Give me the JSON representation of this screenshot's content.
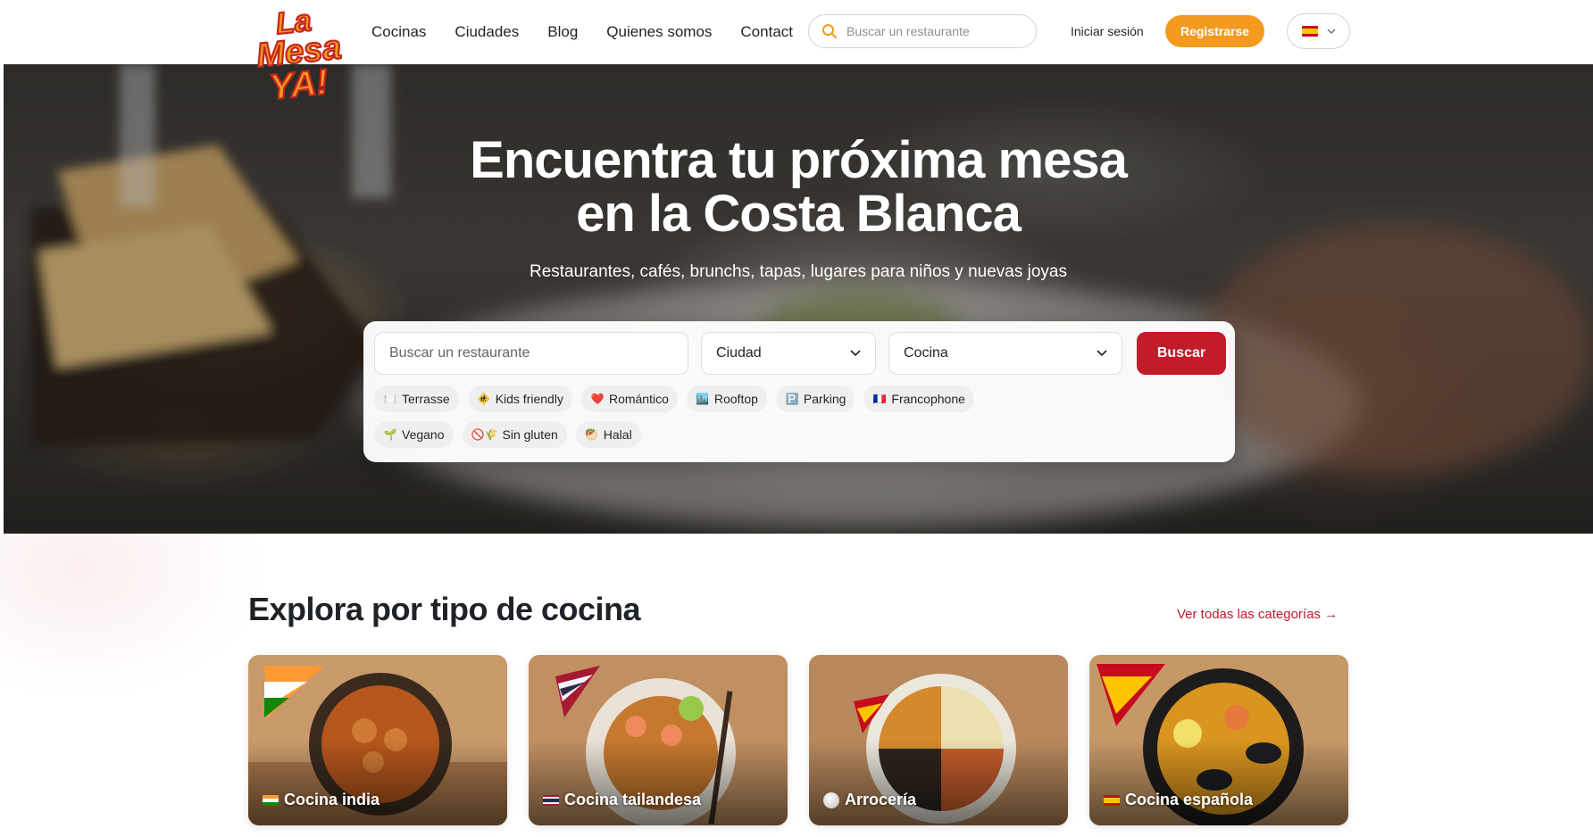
{
  "brand": {
    "logo_line1": "La",
    "logo_line2": "Mesa",
    "logo_line3": "YA!",
    "accent": "#f39a1f",
    "primary_red": "#c21b2a"
  },
  "nav": {
    "links": [
      {
        "label": "Cocinas"
      },
      {
        "label": "Ciudades"
      },
      {
        "label": "Blog"
      },
      {
        "label": "Quienes somos"
      },
      {
        "label": "Contact"
      }
    ],
    "search_placeholder": "Buscar un restaurante",
    "search_icon": "search-icon",
    "login_label": "Iniciar sesión",
    "register_label": "Registrarse",
    "language_flag": "flag-es-icon"
  },
  "hero": {
    "title_line1": "Encuentra tu próxima mesa",
    "title_line2": "en la Costa Blanca",
    "subtitle": "Restaurantes, cafés, brunchs, tapas, lugares para niños y nuevas joyas",
    "search_placeholder": "Buscar un restaurante",
    "city_label": "Ciudad",
    "cuisine_label": "Cocina",
    "search_button": "Buscar",
    "chips": [
      {
        "icon": "🍽️",
        "label": "Terrasse"
      },
      {
        "icon": "🚸",
        "label": "Kids friendly"
      },
      {
        "icon": "❤️",
        "label": "Romántico"
      },
      {
        "icon": "🏙️",
        "label": "Rooftop"
      },
      {
        "icon": "🅿️",
        "label": "Parking"
      },
      {
        "icon": "🇫🇷",
        "label": "Francophone"
      },
      {
        "icon": "🌱",
        "label": "Vegano"
      },
      {
        "icon": "🚫🌾",
        "label": "Sin gluten"
      },
      {
        "icon": "🥙",
        "label": "Halal"
      }
    ]
  },
  "cuisine_section": {
    "title": "Explora por tipo de cocina",
    "see_all": "Ver todas las categorías →",
    "cards": [
      {
        "label": "Cocina india",
        "flag": "flag-india-icon"
      },
      {
        "label": "Cocina tailandesa",
        "flag": "flag-thailand-icon"
      },
      {
        "label": "Arrocería",
        "flag": "rice-icon"
      },
      {
        "label": "Cocina española",
        "flag": "flag-spain-icon"
      }
    ]
  }
}
